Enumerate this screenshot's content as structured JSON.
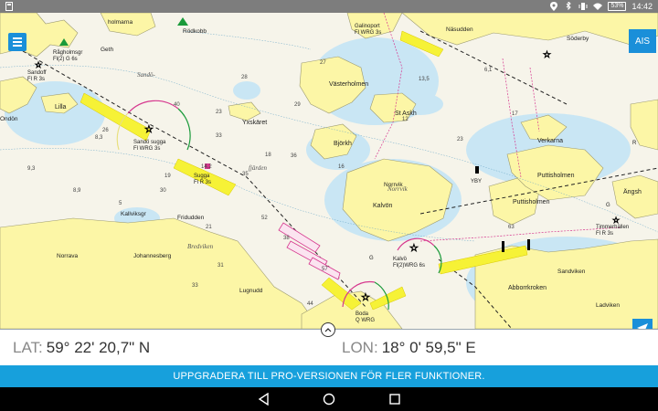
{
  "status_bar": {
    "time": "14:42",
    "battery": "53%",
    "icons": [
      "app-notification-icon",
      "location-icon",
      "bluetooth-icon",
      "vibrate-icon",
      "wifi-icon",
      "battery-icon"
    ]
  },
  "map": {
    "islands": [
      "Västerholmen",
      "St Askh",
      "Björkh",
      "Kalvön",
      "Puttisholmen",
      "Puttisholmen",
      "Verkarna",
      "Abborrkroken",
      "Lilla",
      "Yxskäret",
      "Ängsh"
    ],
    "places": [
      "Geth",
      "holmarna",
      "Rödkobb",
      "Näsudden",
      "Söderby",
      "Fridudden",
      "Johannesberg",
      "Norrava",
      "Kallviksgr",
      "Lugnudd",
      "Norrvik",
      "Sandviken",
      "Ladviken",
      "Ondön"
    ],
    "water_names": [
      "Sandö-",
      "fjärden",
      "Bredviken",
      "Norrvik"
    ],
    "lights": [
      {
        "name": "Sandö sugga",
        "char": "Fl WRG 3s"
      },
      {
        "name": "Sugga",
        "char": "Fl R 3s"
      },
      {
        "name": "Sandoff",
        "char": "Fl R 3s"
      },
      {
        "name": "Rågholmsgr",
        "char": "Fl(2) G 6s"
      },
      {
        "name": "Galinoport",
        "char": "Fl WRG 3s"
      },
      {
        "name": "Kalvö",
        "char": "Fl(2)WRG 6s"
      },
      {
        "name": "Boda",
        "char": "Q WRG"
      },
      {
        "name": "Timmerhällen",
        "char": "Fl R 3s"
      }
    ],
    "buoys": [
      "YBY",
      "G",
      "G",
      "R"
    ],
    "depths": [
      "28",
      "23",
      "33",
      "21",
      "30",
      "29",
      "27",
      "36",
      "40",
      "35",
      "44",
      "18",
      "26",
      "31",
      "8,3",
      "9,3",
      "13,5",
      "6,1",
      "16",
      "14,2",
      "5",
      "52",
      "38",
      "57",
      "63",
      "33",
      "19",
      "12",
      "23",
      "17",
      "8,9"
    ]
  },
  "controls": {
    "menu_label": "Menu",
    "ais_label": "AIS"
  },
  "coordinates": {
    "lat_label": "LAT:",
    "lat_value": "59° 22' 20,7\" N",
    "lon_label": "LON:",
    "lon_value": "18° 0' 59,5\" E"
  },
  "upgrade_banner": "UPPGRADERA TILL PRO-VERSIONEN FÖR FLER FUNKTIONER.",
  "navigation": [
    "back",
    "home",
    "recent"
  ],
  "colors": {
    "land": "#fcf6a6",
    "water": "#f6f4ea",
    "shallow": "#c9e6f4",
    "accent": "#1a8fd9",
    "banner": "#17a0dc"
  }
}
